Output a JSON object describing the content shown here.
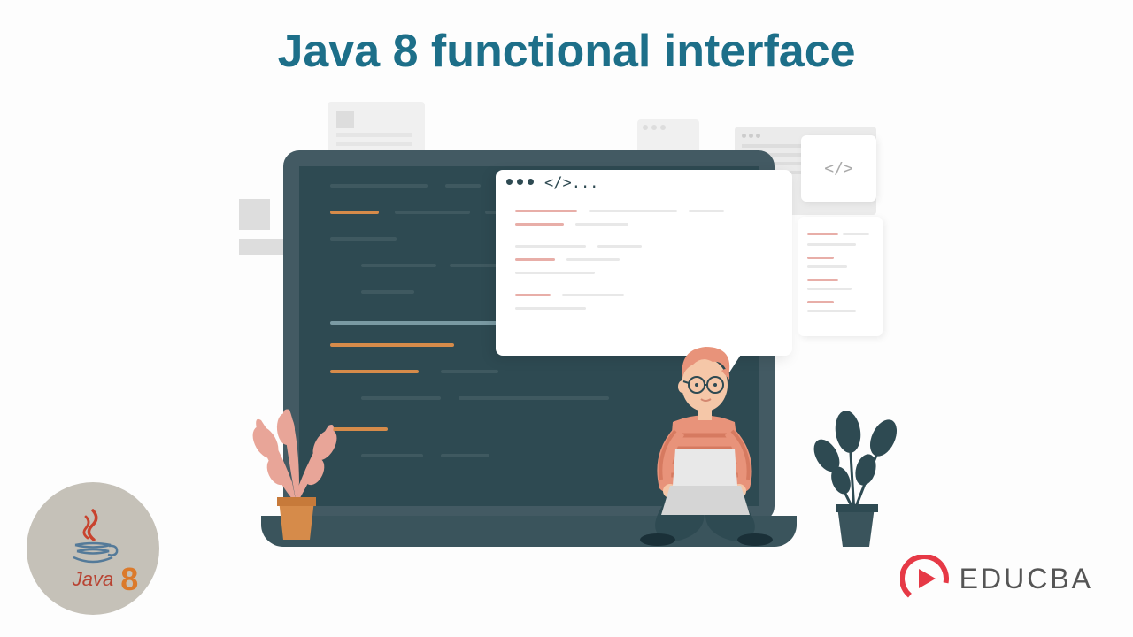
{
  "title": "Java 8 functional interface",
  "code_window_title": "</>...",
  "small_window_top": "</>",
  "java_badge": {
    "text": "Java",
    "version": "8"
  },
  "educba_logo_text": "EDUCBA",
  "colors": {
    "title": "#1d6f89",
    "laptop_screen": "#2e4a52",
    "laptop_border": "#435a63",
    "accent_orange": "#d68b4a",
    "accent_coral": "#e8aea8",
    "educba_red": "#e63946"
  },
  "illustration": {
    "description": "Developer with coral hair and striped shirt sitting cross-legged with laptop in front of large monitor showing code, flanked by plants",
    "elements": [
      "laptop-monitor",
      "code-editor-window",
      "speech-bubble-code",
      "plant-left",
      "plant-right",
      "person-coding",
      "small-laptop"
    ]
  }
}
